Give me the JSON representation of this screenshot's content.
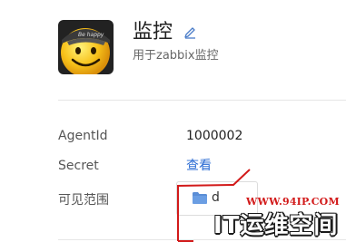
{
  "app": {
    "name": "监控",
    "description": "用于zabbix监控"
  },
  "details": {
    "agent_id_label": "AgentId",
    "agent_id_value": "1000002",
    "secret_label": "Secret",
    "secret_link": "查看",
    "scope_label": "可见范围",
    "scope_value": "d"
  },
  "watermark": {
    "url": "WWW.94IP.COM",
    "name": "IT运维空间"
  },
  "icons": {
    "avatar": "smiley-face-icon",
    "edit": "pencil-icon",
    "folder": "folder-icon"
  },
  "colors": {
    "link": "#2a6bd3",
    "folder": "#5b8ed6",
    "watermark_red": "#d21a1a"
  }
}
